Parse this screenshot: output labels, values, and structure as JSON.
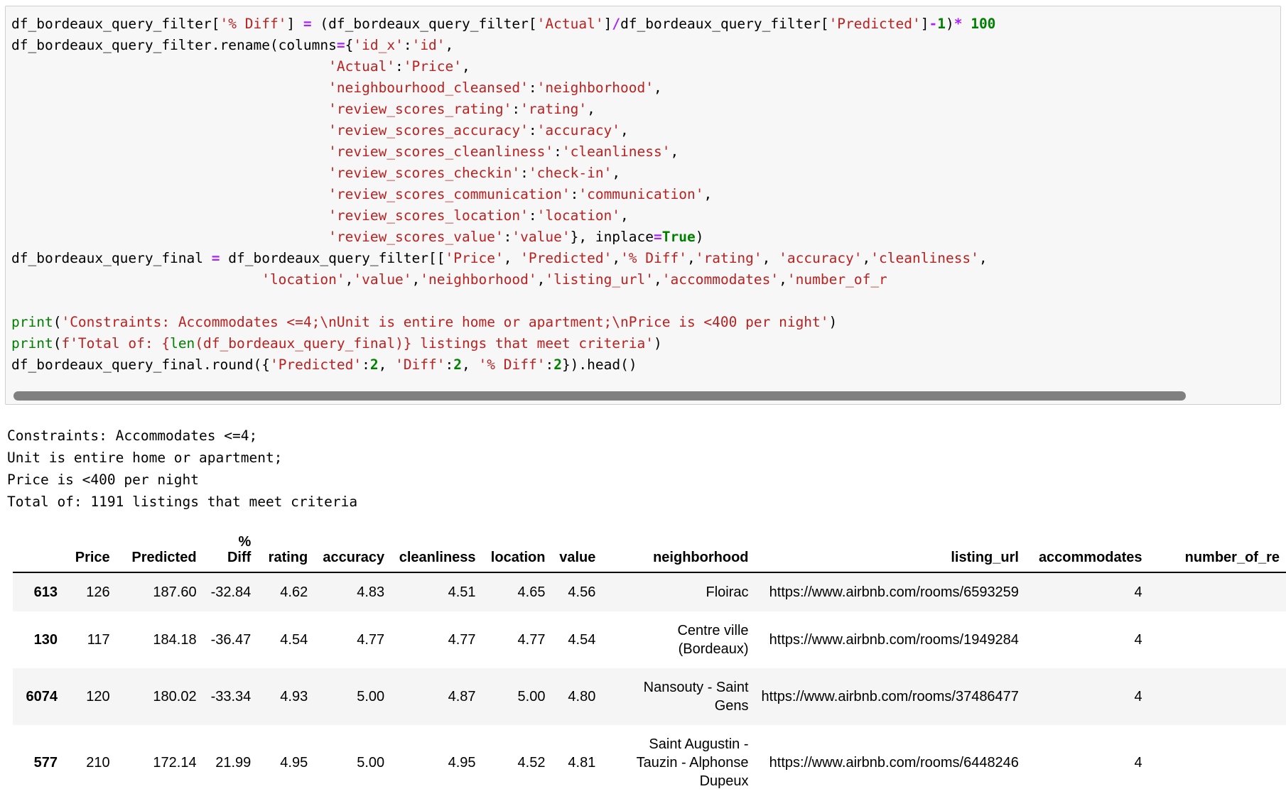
{
  "notebook": {
    "code_cell": {
      "lines": [
        [
          {
            "t": "df_bordeaux_query_filter[",
            "c": "plain"
          },
          {
            "t": "'% Diff'",
            "c": "str"
          },
          {
            "t": "] ",
            "c": "plain"
          },
          {
            "t": "=",
            "c": "op"
          },
          {
            "t": " (df_bordeaux_query_filter[",
            "c": "plain"
          },
          {
            "t": "'Actual'",
            "c": "str"
          },
          {
            "t": "]",
            "c": "plain"
          },
          {
            "t": "/",
            "c": "op"
          },
          {
            "t": "df_bordeaux_query_filter[",
            "c": "plain"
          },
          {
            "t": "'Predicted'",
            "c": "str"
          },
          {
            "t": "]",
            "c": "plain"
          },
          {
            "t": "-",
            "c": "op"
          },
          {
            "t": "1",
            "c": "num"
          },
          {
            "t": ")",
            "c": "plain"
          },
          {
            "t": "*",
            "c": "op"
          },
          {
            "t": " ",
            "c": "plain"
          },
          {
            "t": "100",
            "c": "num"
          }
        ],
        [
          {
            "t": "df_bordeaux_query_filter.rename(columns",
            "c": "plain"
          },
          {
            "t": "=",
            "c": "op"
          },
          {
            "t": "{",
            "c": "plain"
          },
          {
            "t": "'id_x'",
            "c": "str"
          },
          {
            "t": ":",
            "c": "plain"
          },
          {
            "t": "'id'",
            "c": "str"
          },
          {
            "t": ",",
            "c": "plain"
          }
        ],
        [
          {
            "t": "                                      ",
            "c": "plain"
          },
          {
            "t": "'Actual'",
            "c": "str"
          },
          {
            "t": ":",
            "c": "plain"
          },
          {
            "t": "'Price'",
            "c": "str"
          },
          {
            "t": ",",
            "c": "plain"
          }
        ],
        [
          {
            "t": "                                      ",
            "c": "plain"
          },
          {
            "t": "'neighbourhood_cleansed'",
            "c": "str"
          },
          {
            "t": ":",
            "c": "plain"
          },
          {
            "t": "'neighborhood'",
            "c": "str"
          },
          {
            "t": ",",
            "c": "plain"
          }
        ],
        [
          {
            "t": "                                      ",
            "c": "plain"
          },
          {
            "t": "'review_scores_rating'",
            "c": "str"
          },
          {
            "t": ":",
            "c": "plain"
          },
          {
            "t": "'rating'",
            "c": "str"
          },
          {
            "t": ",",
            "c": "plain"
          }
        ],
        [
          {
            "t": "                                      ",
            "c": "plain"
          },
          {
            "t": "'review_scores_accuracy'",
            "c": "str"
          },
          {
            "t": ":",
            "c": "plain"
          },
          {
            "t": "'accuracy'",
            "c": "str"
          },
          {
            "t": ",",
            "c": "plain"
          }
        ],
        [
          {
            "t": "                                      ",
            "c": "plain"
          },
          {
            "t": "'review_scores_cleanliness'",
            "c": "str"
          },
          {
            "t": ":",
            "c": "plain"
          },
          {
            "t": "'cleanliness'",
            "c": "str"
          },
          {
            "t": ",",
            "c": "plain"
          }
        ],
        [
          {
            "t": "                                      ",
            "c": "plain"
          },
          {
            "t": "'review_scores_checkin'",
            "c": "str"
          },
          {
            "t": ":",
            "c": "plain"
          },
          {
            "t": "'check-in'",
            "c": "str"
          },
          {
            "t": ",",
            "c": "plain"
          }
        ],
        [
          {
            "t": "                                      ",
            "c": "plain"
          },
          {
            "t": "'review_scores_communication'",
            "c": "str"
          },
          {
            "t": ":",
            "c": "plain"
          },
          {
            "t": "'communication'",
            "c": "str"
          },
          {
            "t": ",",
            "c": "plain"
          }
        ],
        [
          {
            "t": "                                      ",
            "c": "plain"
          },
          {
            "t": "'review_scores_location'",
            "c": "str"
          },
          {
            "t": ":",
            "c": "plain"
          },
          {
            "t": "'location'",
            "c": "str"
          },
          {
            "t": ",",
            "c": "plain"
          }
        ],
        [
          {
            "t": "                                      ",
            "c": "plain"
          },
          {
            "t": "'review_scores_value'",
            "c": "str"
          },
          {
            "t": ":",
            "c": "plain"
          },
          {
            "t": "'value'",
            "c": "str"
          },
          {
            "t": "}, inplace",
            "c": "plain"
          },
          {
            "t": "=",
            "c": "op"
          },
          {
            "t": "True",
            "c": "kw"
          },
          {
            "t": ")",
            "c": "plain"
          }
        ],
        [
          {
            "t": "df_bordeaux_query_final ",
            "c": "plain"
          },
          {
            "t": "=",
            "c": "op"
          },
          {
            "t": " df_bordeaux_query_filter[[",
            "c": "plain"
          },
          {
            "t": "'Price'",
            "c": "str"
          },
          {
            "t": ", ",
            "c": "plain"
          },
          {
            "t": "'Predicted'",
            "c": "str"
          },
          {
            "t": ",",
            "c": "plain"
          },
          {
            "t": "'% Diff'",
            "c": "str"
          },
          {
            "t": ",",
            "c": "plain"
          },
          {
            "t": "'rating'",
            "c": "str"
          },
          {
            "t": ", ",
            "c": "plain"
          },
          {
            "t": "'accuracy'",
            "c": "str"
          },
          {
            "t": ",",
            "c": "plain"
          },
          {
            "t": "'cleanliness'",
            "c": "str"
          },
          {
            "t": ",",
            "c": "plain"
          }
        ],
        [
          {
            "t": "                              ",
            "c": "plain"
          },
          {
            "t": "'location'",
            "c": "str"
          },
          {
            "t": ",",
            "c": "plain"
          },
          {
            "t": "'value'",
            "c": "str"
          },
          {
            "t": ",",
            "c": "plain"
          },
          {
            "t": "'neighborhood'",
            "c": "str"
          },
          {
            "t": ",",
            "c": "plain"
          },
          {
            "t": "'listing_url'",
            "c": "str"
          },
          {
            "t": ",",
            "c": "plain"
          },
          {
            "t": "'accommodates'",
            "c": "str"
          },
          {
            "t": ",",
            "c": "plain"
          },
          {
            "t": "'number_of_r",
            "c": "str"
          }
        ],
        [
          {
            "t": "",
            "c": "plain"
          }
        ],
        [
          {
            "t": "print",
            "c": "fn"
          },
          {
            "t": "(",
            "c": "plain"
          },
          {
            "t": "'Constraints: Accommodates <=4;\\nUnit is entire home or apartment;\\nPrice is <400 per night'",
            "c": "str"
          },
          {
            "t": ")",
            "c": "plain"
          }
        ],
        [
          {
            "t": "print",
            "c": "fn"
          },
          {
            "t": "(",
            "c": "plain"
          },
          {
            "t": "f'Total of: {",
            "c": "str"
          },
          {
            "t": "len",
            "c": "fn"
          },
          {
            "t": "(df_bordeaux_query_final)} listings that meet criteria'",
            "c": "str"
          },
          {
            "t": ")",
            "c": "plain"
          }
        ],
        [
          {
            "t": "df_bordeaux_query_final.round({",
            "c": "plain"
          },
          {
            "t": "'Predicted'",
            "c": "str"
          },
          {
            "t": ":",
            "c": "plain"
          },
          {
            "t": "2",
            "c": "num"
          },
          {
            "t": ", ",
            "c": "plain"
          },
          {
            "t": "'Diff'",
            "c": "str"
          },
          {
            "t": ":",
            "c": "plain"
          },
          {
            "t": "2",
            "c": "num"
          },
          {
            "t": ", ",
            "c": "plain"
          },
          {
            "t": "'% Diff'",
            "c": "str"
          },
          {
            "t": ":",
            "c": "plain"
          },
          {
            "t": "2",
            "c": "num"
          },
          {
            "t": "}).head()",
            "c": "plain"
          }
        ]
      ],
      "scrollbar": {
        "orientation": "horizontal"
      }
    },
    "stdout": "Constraints: Accommodates <=4;\nUnit is entire home or apartment;\nPrice is <400 per night\nTotal of: 1191 listings that meet criteria",
    "dataframe": {
      "columns": [
        "",
        "Price",
        "Predicted",
        "%\nDiff",
        "rating",
        "accuracy",
        "cleanliness",
        "location",
        "value",
        "neighborhood",
        "listing_url",
        "accommodates",
        "number_of_re"
      ],
      "rows": [
        {
          "index": "613",
          "Price": "126",
          "Predicted": "187.60",
          "pct_diff": "-32.84",
          "rating": "4.62",
          "accuracy": "4.83",
          "cleanliness": "4.51",
          "location": "4.65",
          "value": "4.56",
          "neighborhood": "Floirac",
          "listing_url": "https://www.airbnb.com/rooms/6593259",
          "accommodates": "4",
          "number_of_reviews": ""
        },
        {
          "index": "130",
          "Price": "117",
          "Predicted": "184.18",
          "pct_diff": "-36.47",
          "rating": "4.54",
          "accuracy": "4.77",
          "cleanliness": "4.77",
          "location": "4.77",
          "value": "4.54",
          "neighborhood": "Centre ville (Bordeaux)",
          "listing_url": "https://www.airbnb.com/rooms/1949284",
          "accommodates": "4",
          "number_of_reviews": ""
        },
        {
          "index": "6074",
          "Price": "120",
          "Predicted": "180.02",
          "pct_diff": "-33.34",
          "rating": "4.93",
          "accuracy": "5.00",
          "cleanliness": "4.87",
          "location": "5.00",
          "value": "4.80",
          "neighborhood": "Nansouty - Saint Gens",
          "listing_url": "https://www.airbnb.com/rooms/37486477",
          "accommodates": "4",
          "number_of_reviews": ""
        },
        {
          "index": "577",
          "Price": "210",
          "Predicted": "172.14",
          "pct_diff": "21.99",
          "rating": "4.95",
          "accuracy": "5.00",
          "cleanliness": "4.95",
          "location": "4.52",
          "value": "4.81",
          "neighborhood": "Saint Augustin - Tauzin - Alphonse Dupeux",
          "listing_url": "https://www.airbnb.com/rooms/6448246",
          "accommodates": "4",
          "number_of_reviews": ""
        }
      ]
    }
  },
  "colors": {
    "string": "#ba2121",
    "operator": "#aa22ff",
    "number": "#008000",
    "keyword": "#008000",
    "cell_bg": "#f7f7f7",
    "cell_border": "#cfcfcf",
    "scrollbar": "#808080",
    "row_stripe": "#f5f5f5"
  }
}
